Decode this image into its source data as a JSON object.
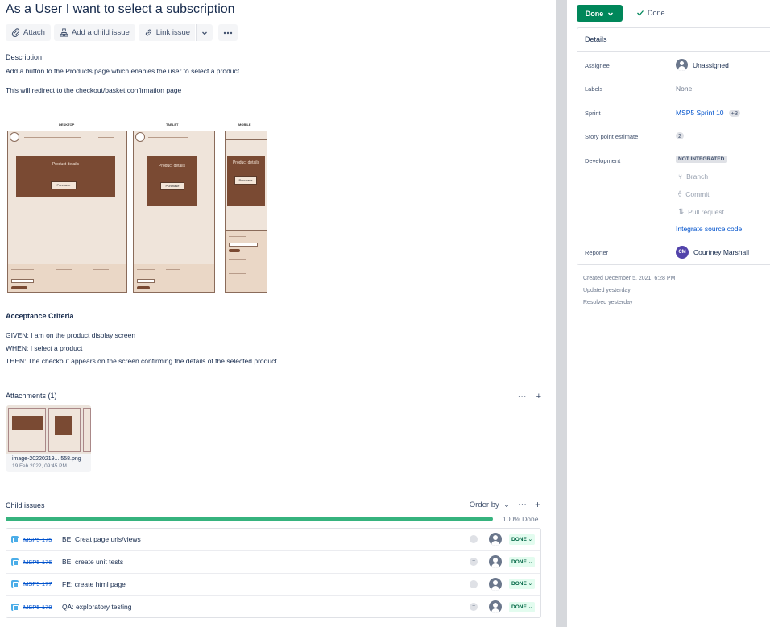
{
  "issue": {
    "title": "As a User I want to select a subscription",
    "toolbar": {
      "attach": "Attach",
      "add_child": "Add a child issue",
      "link_issue": "Link issue"
    },
    "description_label": "Description",
    "description_lines": [
      "Add a button to the Products page which enables the user to select a product",
      "This will redirect to the checkout/basket confirmation page"
    ],
    "wireframe": {
      "desktop_caption": "DESKTOP",
      "tablet_caption": "TABLET",
      "mobile_caption": "MOBILE",
      "box_text": "Product details",
      "button_text": "Purchase"
    },
    "acceptance_label": "Acceptance Criteria",
    "acceptance_lines": [
      "GIVEN: I am on the product display screen",
      "WHEN: I select a product",
      "THEN: The checkout appears on the screen confirming the details of the selected product"
    ],
    "attachments": {
      "label": "Attachments (1)",
      "file_name": "image-20220219... 558.png",
      "file_date": "19 Feb 2022, 09:45 PM"
    },
    "child_issues": {
      "label": "Child issues",
      "order_by": "Order by",
      "progress_percent": 100,
      "progress_text": "100% Done",
      "items": [
        {
          "key": "MSP5-175",
          "summary": "BE: Creat page urls/views",
          "status": "DONE"
        },
        {
          "key": "MSP5-176",
          "summary": "BE: create unit tests",
          "status": "DONE"
        },
        {
          "key": "MSP5-177",
          "summary": "FE: create html page",
          "status": "DONE"
        },
        {
          "key": "MSP5-178",
          "summary": "QA: exploratory testing",
          "status": "DONE"
        }
      ]
    }
  },
  "sidebar": {
    "status_button": "Done",
    "resolution": "Done",
    "details_title": "Details",
    "fields": {
      "assignee_label": "Assignee",
      "assignee_value": "Unassigned",
      "labels_label": "Labels",
      "labels_value": "None",
      "sprint_label": "Sprint",
      "sprint_value": "MSP5 Sprint 10",
      "sprint_more": "+3",
      "story_points_label": "Story point estimate",
      "story_points_value": "2",
      "development_label": "Development",
      "development_badge": "NOT INTEGRATED",
      "dev_branch": "Branch",
      "dev_commit": "Commit",
      "dev_pull_request": "Pull request",
      "dev_integrate": "Integrate source code",
      "reporter_label": "Reporter",
      "reporter_initials": "CM",
      "reporter_value": "Courtney Marshall"
    },
    "meta": {
      "created": "Created December 5, 2021, 6:28 PM",
      "updated": "Updated yesterday",
      "resolved": "Resolved yesterday"
    }
  },
  "colors": {
    "done_green": "#00875a",
    "progress_green": "#36b37e",
    "link_blue": "#0052cc",
    "wireframe_brown": "#7a4a33"
  }
}
